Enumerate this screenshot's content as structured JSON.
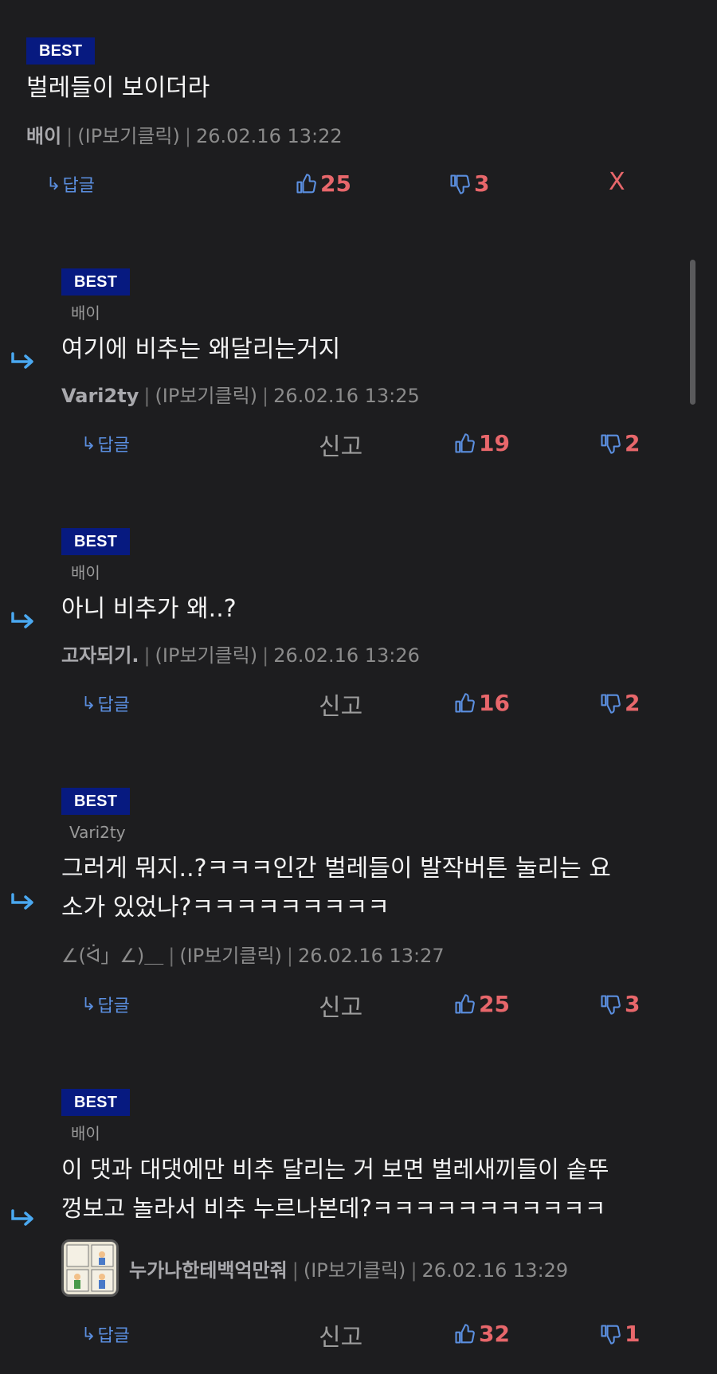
{
  "comments": [
    {
      "badge": "BEST",
      "reply_to": "",
      "text": "벌레들이 보이더라",
      "author": "배이",
      "ip": "(IP보기클릭)",
      "time": "26.02.16 13:22",
      "reply_label": "답글",
      "report_label": "",
      "x_label": "X",
      "likes": "25",
      "dislikes": "3"
    },
    {
      "badge": "BEST",
      "reply_to": "배이",
      "text": "여기에 비추는 왜달리는거지",
      "author": "Vari2ty",
      "ip": "(IP보기클릭)",
      "time": "26.02.16 13:25",
      "reply_label": "답글",
      "report_label": "신고",
      "likes": "19",
      "dislikes": "2"
    },
    {
      "badge": "BEST",
      "reply_to": "배이",
      "text": "아니 비추가 왜..?",
      "author": "고자되기.",
      "ip": "(IP보기클릭)",
      "time": "26.02.16 13:26",
      "reply_label": "답글",
      "report_label": "신고",
      "likes": "16",
      "dislikes": "2"
    },
    {
      "badge": "BEST",
      "reply_to": "Vari2ty",
      "text": "그러게 뭐지..?ㅋㅋㅋ인간 벌레들이 발작버튼 눌리는 요\n소가 있었나?ㅋㅋㅋㅋㅋㅋㅋㅋㅋ",
      "author": "∠(ᐛ」∠)＿",
      "ip": "(IP보기클릭)",
      "time": "26.02.16 13:27",
      "reply_label": "답글",
      "report_label": "신고",
      "likes": "25",
      "dislikes": "3"
    },
    {
      "badge": "BEST",
      "reply_to": "배이",
      "text": "이 댓과 대댓에만 비추 달리는 거 보면 벌레새끼들이 솥뚜\n껑보고 놀라서 비추 누르나본데?ㅋㅋㅋㅋㅋㅋㅋㅋㅋㅋㅋ",
      "author": "누가나한테백억만줘",
      "ip": "(IP보기클릭)",
      "time": "26.02.16 13:29",
      "reply_label": "답글",
      "report_label": "신고",
      "likes": "32",
      "dislikes": "1"
    }
  ],
  "colors": {
    "background": "#1d1d1f",
    "badge": "#071a80",
    "vote": "#e8676b",
    "accent_blue": "#5b8fe0",
    "reply_arrow": "#4aa8f0"
  },
  "icons": {
    "thumbs_up": "thumbs-up-icon",
    "thumbs_down": "thumbs-down-icon",
    "reply_arrow": "reply-arrow-icon"
  }
}
